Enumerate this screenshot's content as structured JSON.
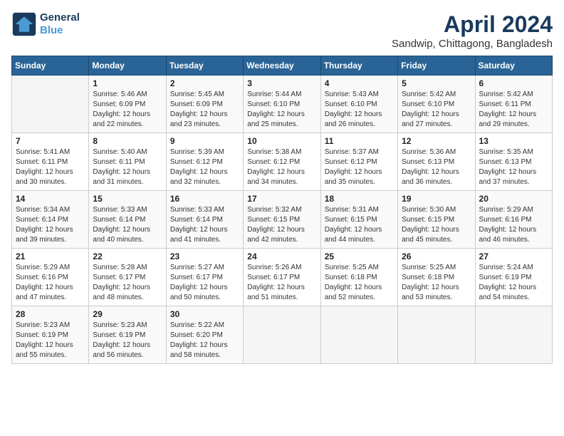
{
  "header": {
    "logo_line1": "General",
    "logo_line2": "Blue",
    "month_year": "April 2024",
    "location": "Sandwip, Chittagong, Bangladesh"
  },
  "weekdays": [
    "Sunday",
    "Monday",
    "Tuesday",
    "Wednesday",
    "Thursday",
    "Friday",
    "Saturday"
  ],
  "weeks": [
    [
      {
        "day": "",
        "info": ""
      },
      {
        "day": "1",
        "info": "Sunrise: 5:46 AM\nSunset: 6:09 PM\nDaylight: 12 hours\nand 22 minutes."
      },
      {
        "day": "2",
        "info": "Sunrise: 5:45 AM\nSunset: 6:09 PM\nDaylight: 12 hours\nand 23 minutes."
      },
      {
        "day": "3",
        "info": "Sunrise: 5:44 AM\nSunset: 6:10 PM\nDaylight: 12 hours\nand 25 minutes."
      },
      {
        "day": "4",
        "info": "Sunrise: 5:43 AM\nSunset: 6:10 PM\nDaylight: 12 hours\nand 26 minutes."
      },
      {
        "day": "5",
        "info": "Sunrise: 5:42 AM\nSunset: 6:10 PM\nDaylight: 12 hours\nand 27 minutes."
      },
      {
        "day": "6",
        "info": "Sunrise: 5:42 AM\nSunset: 6:11 PM\nDaylight: 12 hours\nand 29 minutes."
      }
    ],
    [
      {
        "day": "7",
        "info": "Sunrise: 5:41 AM\nSunset: 6:11 PM\nDaylight: 12 hours\nand 30 minutes."
      },
      {
        "day": "8",
        "info": "Sunrise: 5:40 AM\nSunset: 6:11 PM\nDaylight: 12 hours\nand 31 minutes."
      },
      {
        "day": "9",
        "info": "Sunrise: 5:39 AM\nSunset: 6:12 PM\nDaylight: 12 hours\nand 32 minutes."
      },
      {
        "day": "10",
        "info": "Sunrise: 5:38 AM\nSunset: 6:12 PM\nDaylight: 12 hours\nand 34 minutes."
      },
      {
        "day": "11",
        "info": "Sunrise: 5:37 AM\nSunset: 6:12 PM\nDaylight: 12 hours\nand 35 minutes."
      },
      {
        "day": "12",
        "info": "Sunrise: 5:36 AM\nSunset: 6:13 PM\nDaylight: 12 hours\nand 36 minutes."
      },
      {
        "day": "13",
        "info": "Sunrise: 5:35 AM\nSunset: 6:13 PM\nDaylight: 12 hours\nand 37 minutes."
      }
    ],
    [
      {
        "day": "14",
        "info": "Sunrise: 5:34 AM\nSunset: 6:14 PM\nDaylight: 12 hours\nand 39 minutes."
      },
      {
        "day": "15",
        "info": "Sunrise: 5:33 AM\nSunset: 6:14 PM\nDaylight: 12 hours\nand 40 minutes."
      },
      {
        "day": "16",
        "info": "Sunrise: 5:33 AM\nSunset: 6:14 PM\nDaylight: 12 hours\nand 41 minutes."
      },
      {
        "day": "17",
        "info": "Sunrise: 5:32 AM\nSunset: 6:15 PM\nDaylight: 12 hours\nand 42 minutes."
      },
      {
        "day": "18",
        "info": "Sunrise: 5:31 AM\nSunset: 6:15 PM\nDaylight: 12 hours\nand 44 minutes."
      },
      {
        "day": "19",
        "info": "Sunrise: 5:30 AM\nSunset: 6:15 PM\nDaylight: 12 hours\nand 45 minutes."
      },
      {
        "day": "20",
        "info": "Sunrise: 5:29 AM\nSunset: 6:16 PM\nDaylight: 12 hours\nand 46 minutes."
      }
    ],
    [
      {
        "day": "21",
        "info": "Sunrise: 5:29 AM\nSunset: 6:16 PM\nDaylight: 12 hours\nand 47 minutes."
      },
      {
        "day": "22",
        "info": "Sunrise: 5:28 AM\nSunset: 6:17 PM\nDaylight: 12 hours\nand 48 minutes."
      },
      {
        "day": "23",
        "info": "Sunrise: 5:27 AM\nSunset: 6:17 PM\nDaylight: 12 hours\nand 50 minutes."
      },
      {
        "day": "24",
        "info": "Sunrise: 5:26 AM\nSunset: 6:17 PM\nDaylight: 12 hours\nand 51 minutes."
      },
      {
        "day": "25",
        "info": "Sunrise: 5:25 AM\nSunset: 6:18 PM\nDaylight: 12 hours\nand 52 minutes."
      },
      {
        "day": "26",
        "info": "Sunrise: 5:25 AM\nSunset: 6:18 PM\nDaylight: 12 hours\nand 53 minutes."
      },
      {
        "day": "27",
        "info": "Sunrise: 5:24 AM\nSunset: 6:19 PM\nDaylight: 12 hours\nand 54 minutes."
      }
    ],
    [
      {
        "day": "28",
        "info": "Sunrise: 5:23 AM\nSunset: 6:19 PM\nDaylight: 12 hours\nand 55 minutes."
      },
      {
        "day": "29",
        "info": "Sunrise: 5:23 AM\nSunset: 6:19 PM\nDaylight: 12 hours\nand 56 minutes."
      },
      {
        "day": "30",
        "info": "Sunrise: 5:22 AM\nSunset: 6:20 PM\nDaylight: 12 hours\nand 58 minutes."
      },
      {
        "day": "",
        "info": ""
      },
      {
        "day": "",
        "info": ""
      },
      {
        "day": "",
        "info": ""
      },
      {
        "day": "",
        "info": ""
      }
    ]
  ]
}
